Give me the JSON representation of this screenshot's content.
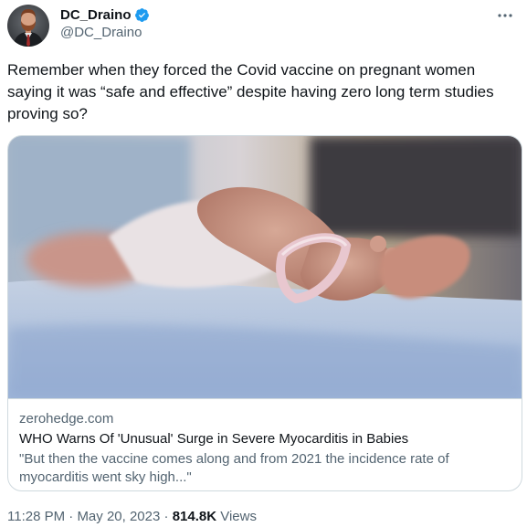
{
  "author": {
    "display_name": "DC_Draino",
    "handle": "@DC_Draino",
    "verified": true
  },
  "tweet": {
    "text": "Remember when they forced the Covid vaccine on pregnant women\nsaying it was “safe and effective” despite having zero long term studies\nproving so?"
  },
  "card": {
    "domain": "zerohedge.com",
    "title": "WHO Warns Of 'Unusual' Surge in Severe Myocarditis in Babies",
    "description": "\"But then the vaccine comes along and from 2021 the incidence rate of\nmyocarditis went sky high...\""
  },
  "footer": {
    "time": "11:28 PM",
    "separator": "·",
    "date": "May 20, 2023",
    "views_count": "814.8K",
    "views_label": "Views"
  },
  "colors": {
    "text_primary": "#0f1419",
    "text_secondary": "#536471",
    "verified": "#1d9bf0",
    "border": "#cfd9de"
  },
  "icons": {
    "verified": "verified-badge-icon",
    "more": "more-options-icon"
  }
}
